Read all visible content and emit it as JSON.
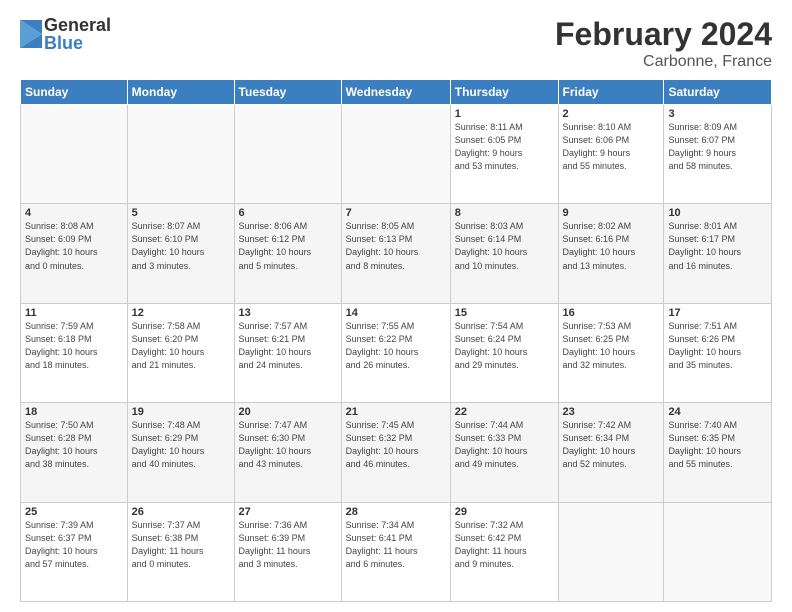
{
  "logo": {
    "general": "General",
    "blue": "Blue"
  },
  "title": "February 2024",
  "location": "Carbonne, France",
  "days_of_week": [
    "Sunday",
    "Monday",
    "Tuesday",
    "Wednesday",
    "Thursday",
    "Friday",
    "Saturday"
  ],
  "weeks": [
    [
      {
        "day": "",
        "info": ""
      },
      {
        "day": "",
        "info": ""
      },
      {
        "day": "",
        "info": ""
      },
      {
        "day": "",
        "info": ""
      },
      {
        "day": "1",
        "info": "Sunrise: 8:11 AM\nSunset: 6:05 PM\nDaylight: 9 hours\nand 53 minutes."
      },
      {
        "day": "2",
        "info": "Sunrise: 8:10 AM\nSunset: 6:06 PM\nDaylight: 9 hours\nand 55 minutes."
      },
      {
        "day": "3",
        "info": "Sunrise: 8:09 AM\nSunset: 6:07 PM\nDaylight: 9 hours\nand 58 minutes."
      }
    ],
    [
      {
        "day": "4",
        "info": "Sunrise: 8:08 AM\nSunset: 6:09 PM\nDaylight: 10 hours\nand 0 minutes."
      },
      {
        "day": "5",
        "info": "Sunrise: 8:07 AM\nSunset: 6:10 PM\nDaylight: 10 hours\nand 3 minutes."
      },
      {
        "day": "6",
        "info": "Sunrise: 8:06 AM\nSunset: 6:12 PM\nDaylight: 10 hours\nand 5 minutes."
      },
      {
        "day": "7",
        "info": "Sunrise: 8:05 AM\nSunset: 6:13 PM\nDaylight: 10 hours\nand 8 minutes."
      },
      {
        "day": "8",
        "info": "Sunrise: 8:03 AM\nSunset: 6:14 PM\nDaylight: 10 hours\nand 10 minutes."
      },
      {
        "day": "9",
        "info": "Sunrise: 8:02 AM\nSunset: 6:16 PM\nDaylight: 10 hours\nand 13 minutes."
      },
      {
        "day": "10",
        "info": "Sunrise: 8:01 AM\nSunset: 6:17 PM\nDaylight: 10 hours\nand 16 minutes."
      }
    ],
    [
      {
        "day": "11",
        "info": "Sunrise: 7:59 AM\nSunset: 6:18 PM\nDaylight: 10 hours\nand 18 minutes."
      },
      {
        "day": "12",
        "info": "Sunrise: 7:58 AM\nSunset: 6:20 PM\nDaylight: 10 hours\nand 21 minutes."
      },
      {
        "day": "13",
        "info": "Sunrise: 7:57 AM\nSunset: 6:21 PM\nDaylight: 10 hours\nand 24 minutes."
      },
      {
        "day": "14",
        "info": "Sunrise: 7:55 AM\nSunset: 6:22 PM\nDaylight: 10 hours\nand 26 minutes."
      },
      {
        "day": "15",
        "info": "Sunrise: 7:54 AM\nSunset: 6:24 PM\nDaylight: 10 hours\nand 29 minutes."
      },
      {
        "day": "16",
        "info": "Sunrise: 7:53 AM\nSunset: 6:25 PM\nDaylight: 10 hours\nand 32 minutes."
      },
      {
        "day": "17",
        "info": "Sunrise: 7:51 AM\nSunset: 6:26 PM\nDaylight: 10 hours\nand 35 minutes."
      }
    ],
    [
      {
        "day": "18",
        "info": "Sunrise: 7:50 AM\nSunset: 6:28 PM\nDaylight: 10 hours\nand 38 minutes."
      },
      {
        "day": "19",
        "info": "Sunrise: 7:48 AM\nSunset: 6:29 PM\nDaylight: 10 hours\nand 40 minutes."
      },
      {
        "day": "20",
        "info": "Sunrise: 7:47 AM\nSunset: 6:30 PM\nDaylight: 10 hours\nand 43 minutes."
      },
      {
        "day": "21",
        "info": "Sunrise: 7:45 AM\nSunset: 6:32 PM\nDaylight: 10 hours\nand 46 minutes."
      },
      {
        "day": "22",
        "info": "Sunrise: 7:44 AM\nSunset: 6:33 PM\nDaylight: 10 hours\nand 49 minutes."
      },
      {
        "day": "23",
        "info": "Sunrise: 7:42 AM\nSunset: 6:34 PM\nDaylight: 10 hours\nand 52 minutes."
      },
      {
        "day": "24",
        "info": "Sunrise: 7:40 AM\nSunset: 6:35 PM\nDaylight: 10 hours\nand 55 minutes."
      }
    ],
    [
      {
        "day": "25",
        "info": "Sunrise: 7:39 AM\nSunset: 6:37 PM\nDaylight: 10 hours\nand 57 minutes."
      },
      {
        "day": "26",
        "info": "Sunrise: 7:37 AM\nSunset: 6:38 PM\nDaylight: 11 hours\nand 0 minutes."
      },
      {
        "day": "27",
        "info": "Sunrise: 7:36 AM\nSunset: 6:39 PM\nDaylight: 11 hours\nand 3 minutes."
      },
      {
        "day": "28",
        "info": "Sunrise: 7:34 AM\nSunset: 6:41 PM\nDaylight: 11 hours\nand 6 minutes."
      },
      {
        "day": "29",
        "info": "Sunrise: 7:32 AM\nSunset: 6:42 PM\nDaylight: 11 hours\nand 9 minutes."
      },
      {
        "day": "",
        "info": ""
      },
      {
        "day": "",
        "info": ""
      }
    ]
  ]
}
